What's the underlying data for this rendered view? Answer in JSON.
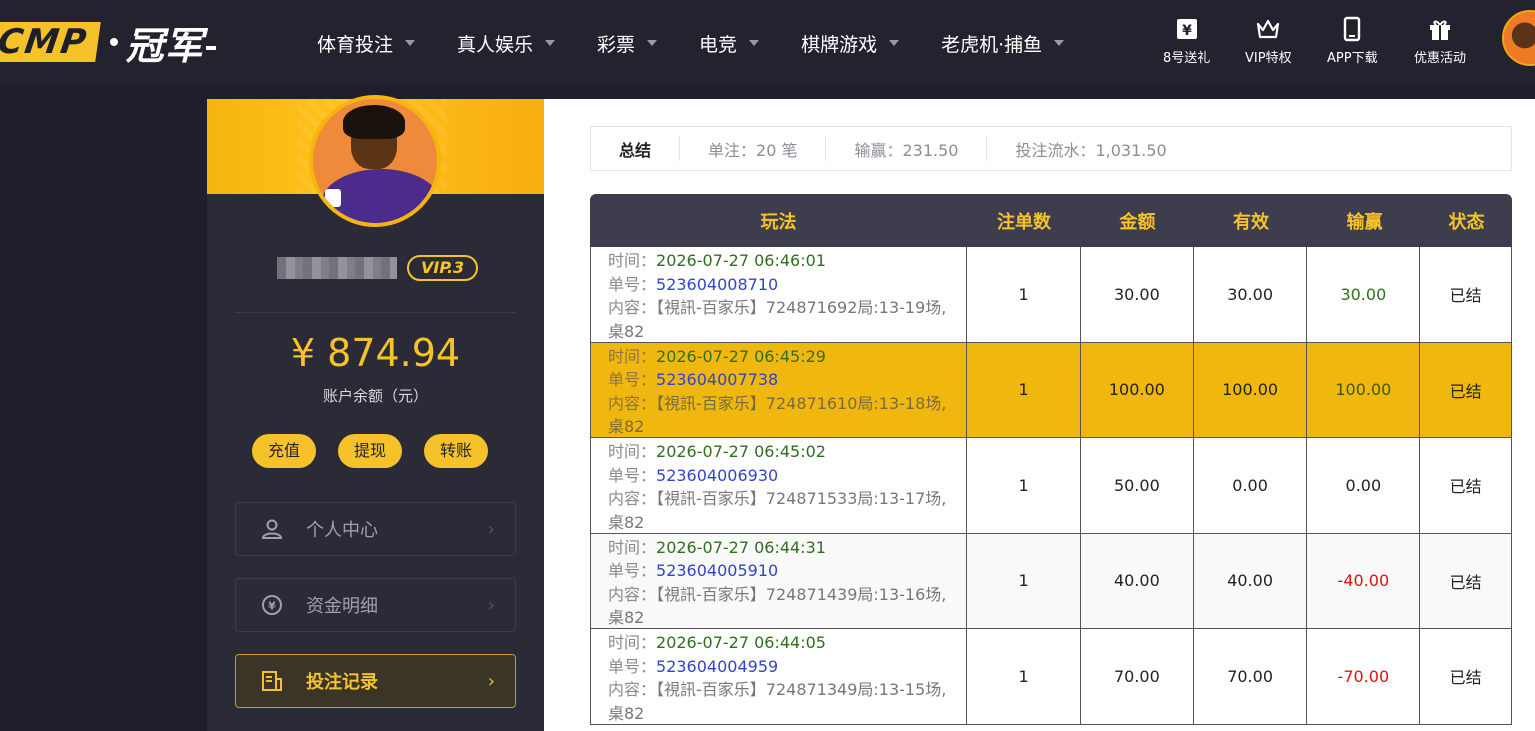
{
  "brand": {
    "logo_text": "CMP",
    "logo_cn": "冠军"
  },
  "nav": [
    {
      "label": "体育投注"
    },
    {
      "label": "真人娱乐"
    },
    {
      "label": "彩票"
    },
    {
      "label": "电竞"
    },
    {
      "label": "棋牌游戏"
    },
    {
      "label": "老虎机·捕鱼"
    }
  ],
  "quick_links": [
    {
      "label": "8号送礼",
      "icon": "yen-ticket-icon"
    },
    {
      "label": "VIP特权",
      "icon": "crown-icon"
    },
    {
      "label": "APP下载",
      "icon": "phone-icon"
    },
    {
      "label": "优惠活动",
      "icon": "gift-icon"
    }
  ],
  "profile": {
    "vip_badge": "VIP.3",
    "balance": "¥ 874.94",
    "balance_label": "账户余额（元）",
    "actions": [
      "充值",
      "提现",
      "转账"
    ]
  },
  "side_menu": [
    {
      "label": "个人中心",
      "icon": "user-icon",
      "arrow": "›"
    },
    {
      "label": "资金明细",
      "icon": "money-exchange-icon",
      "arrow": "›"
    },
    {
      "label": "投注记录",
      "icon": "bet-record-icon",
      "arrow": "›",
      "active": true
    }
  ],
  "summary": {
    "title": "总结",
    "bets": "单注：20 笔",
    "win_loss": "输赢：231.50",
    "turnover": "投注流水：1,031.50"
  },
  "table": {
    "headers": [
      "玩法",
      "注单数",
      "金额",
      "有效",
      "输赢",
      "状态"
    ],
    "labels": {
      "time": "时间：",
      "order": "单号：",
      "content": "内容："
    },
    "rows": [
      {
        "time": "2026-07-27 06:46:01",
        "order": "523604008710",
        "content": "【視訊-百家乐】724871692局:13-19场,桌82",
        "count": "1",
        "amount": "30.00",
        "valid": "30.00",
        "winloss": "30.00",
        "status": "已结"
      },
      {
        "time": "2026-07-27 06:45:29",
        "order": "523604007738",
        "content": "【視訊-百家乐】724871610局:13-18场,桌82",
        "count": "1",
        "amount": "100.00",
        "valid": "100.00",
        "winloss": "100.00",
        "status": "已结"
      },
      {
        "time": "2026-07-27 06:45:02",
        "order": "523604006930",
        "content": "【視訊-百家乐】724871533局:13-17场,桌82",
        "count": "1",
        "amount": "50.00",
        "valid": "0.00",
        "winloss": "0.00",
        "status": "已结"
      },
      {
        "time": "2026-07-27 06:44:31",
        "order": "523604005910",
        "content": "【視訊-百家乐】724871439局:13-16场,桌82",
        "count": "1",
        "amount": "40.00",
        "valid": "40.00",
        "winloss": "-40.00",
        "status": "已结"
      },
      {
        "time": "2026-07-27 06:44:05",
        "order": "523604004959",
        "content": "【視訊-百家乐】724871349局:13-15场,桌82",
        "count": "1",
        "amount": "70.00",
        "valid": "70.00",
        "winloss": "-70.00",
        "status": "已结"
      }
    ]
  },
  "colors": {
    "accent": "#f6c22a",
    "nav_bg": "#23232f",
    "win": "#2f6f1f",
    "loss": "#e01010",
    "order_link": "#3045c8"
  }
}
